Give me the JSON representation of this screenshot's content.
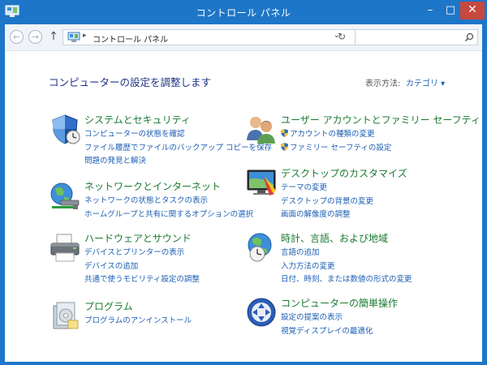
{
  "window": {
    "title": "コントロール パネル",
    "controls": {
      "minimize": "–",
      "maximize": "□",
      "close": "✕"
    }
  },
  "nav": {
    "address": "コントロール パネル",
    "address_sep": "▸",
    "search_placeholder": ""
  },
  "main": {
    "heading": "コンピューターの設定を調整します",
    "view_by_label": "表示方法:",
    "view_by_value": "カテゴリ ▾"
  },
  "categories": [
    {
      "title": "システムとセキュリティ",
      "icon": "shield-icon",
      "links": [
        "コンピューターの状態を確認",
        "ファイル履歴でファイルのバックアップ コピーを保存",
        "問題の発見と解決"
      ]
    },
    {
      "title": "ネットワークとインターネット",
      "icon": "network-icon",
      "links": [
        "ネットワークの状態とタスクの表示",
        "ホームグループと共有に関するオプションの選択"
      ]
    },
    {
      "title": "ハードウェアとサウンド",
      "icon": "printer-icon",
      "links": [
        "デバイスとプリンターの表示",
        "デバイスの追加",
        "共通で使うモビリティ設定の調整"
      ]
    },
    {
      "title": "プログラム",
      "icon": "programs-icon",
      "links": [
        "プログラムのアンインストール"
      ]
    },
    {
      "title": "ユーザー アカウントとファミリー セーフティ",
      "icon": "users-icon",
      "links": [
        "アカウントの種類の変更",
        "ファミリー セーフティの設定"
      ]
    },
    {
      "title": "デスクトップのカスタマイズ",
      "icon": "desktop-icon",
      "links": [
        "テーマの変更",
        "デスクトップの背景の変更",
        "画面の解像度の調整"
      ]
    },
    {
      "title": "時計、言語、および地域",
      "icon": "globe-clock-icon",
      "links": [
        "言語の追加",
        "入力方法の変更",
        "日付、時刻、または数値の形式の変更"
      ]
    },
    {
      "title": "コンピューターの簡単操作",
      "icon": "ease-of-access-icon",
      "links": [
        "設定の提案の表示",
        "視覚ディスプレイの最適化"
      ]
    }
  ]
}
